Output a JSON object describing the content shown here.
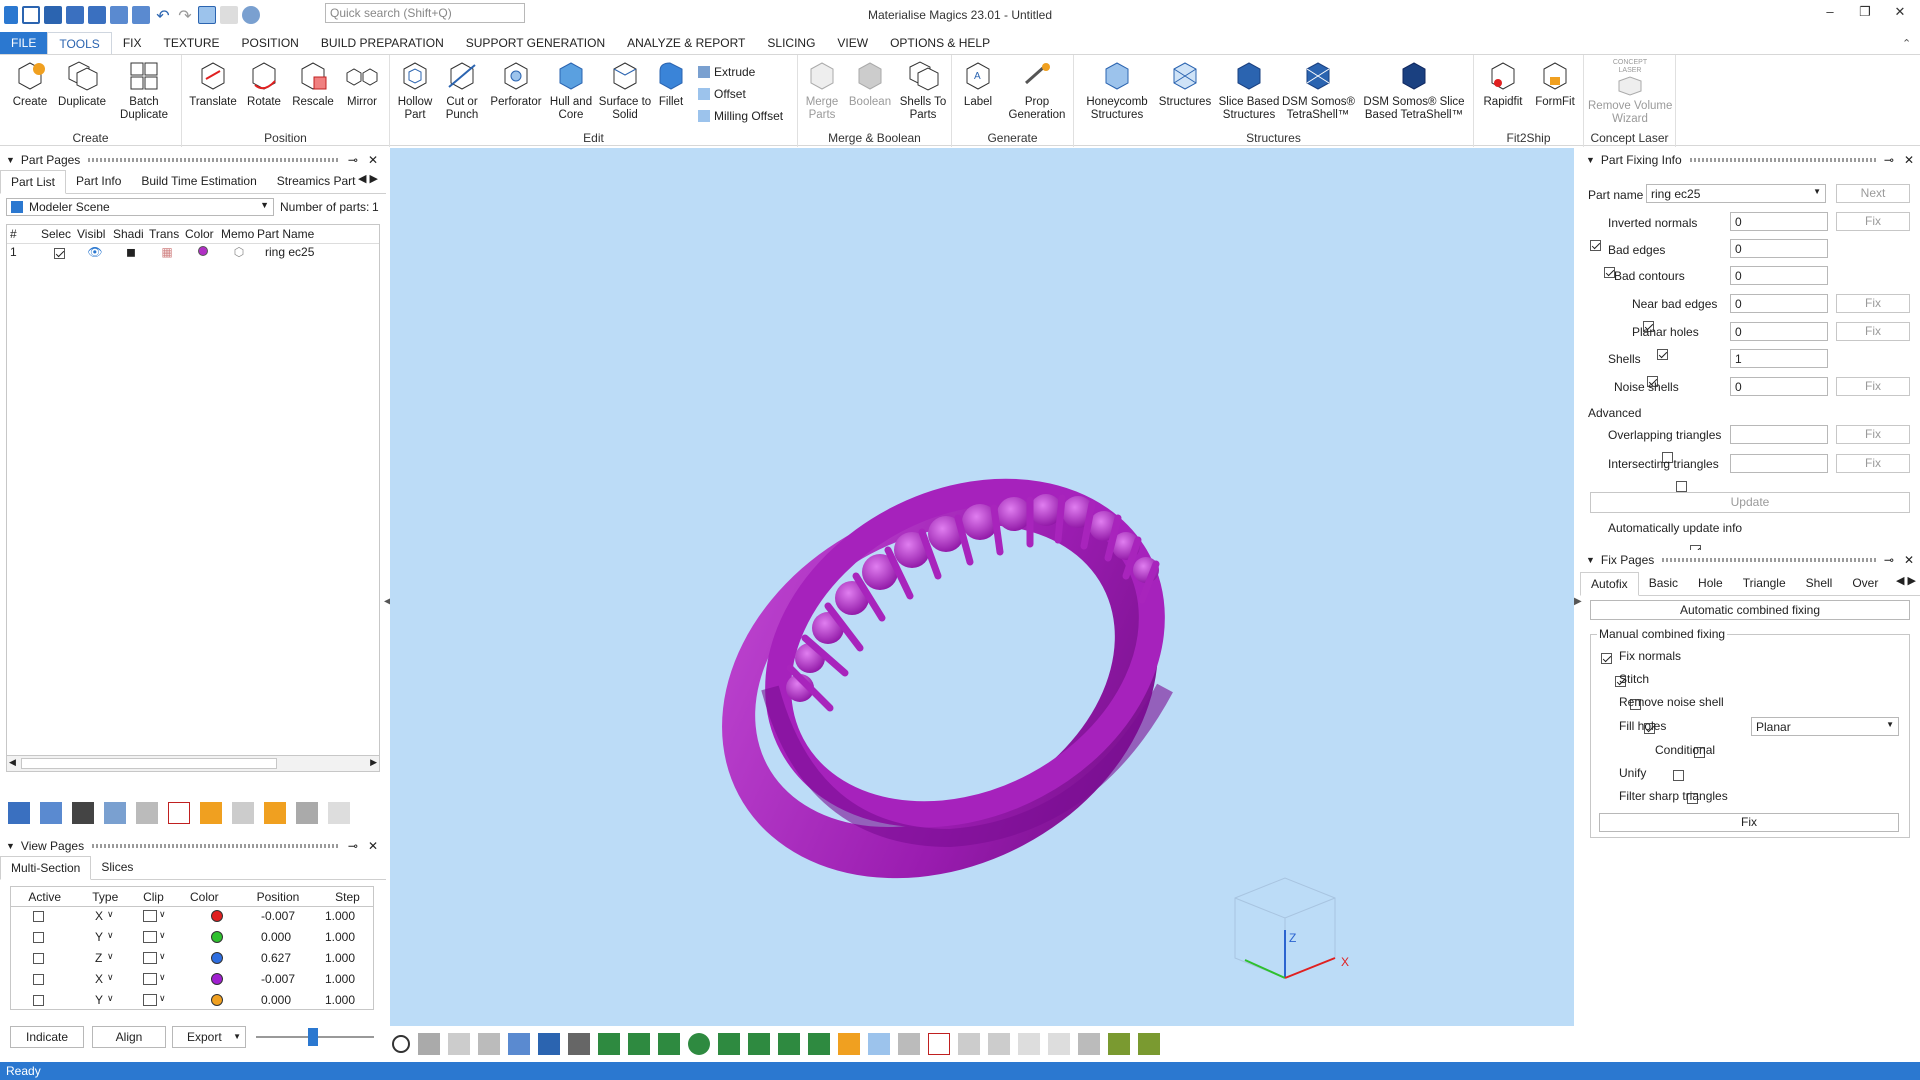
{
  "window": {
    "title": "Materialise Magics 23.01 - Untitled",
    "search_placeholder": "Quick search (Shift+Q)"
  },
  "menu": [
    "FILE",
    "TOOLS",
    "FIX",
    "TEXTURE",
    "POSITION",
    "BUILD PREPARATION",
    "SUPPORT GENERATION",
    "ANALYZE & REPORT",
    "SLICING",
    "VIEW",
    "OPTIONS & HELP"
  ],
  "ribbon": {
    "create": {
      "label": "Create",
      "buttons": [
        "Create",
        "Duplicate",
        "Batch\nDuplicate"
      ]
    },
    "position": {
      "label": "Position",
      "buttons": [
        "Translate",
        "Rotate",
        "Rescale",
        "Mirror"
      ]
    },
    "edit": {
      "label": "Edit",
      "buttons": [
        "Hollow\nPart",
        "Cut or\nPunch",
        "Perforator",
        "Hull and\nCore",
        "Surface to\nSolid",
        "Fillet"
      ],
      "small": [
        "Extrude",
        "Offset",
        "Milling Offset"
      ]
    },
    "merge": {
      "label": "Merge & Boolean",
      "buttons": [
        "Merge\nParts",
        "Boolean",
        "Shells To\nParts"
      ]
    },
    "generate": {
      "label": "Generate",
      "buttons": [
        "Label",
        "Prop\nGeneration"
      ]
    },
    "structures": {
      "label": "Structures",
      "buttons": [
        "Honeycomb\nStructures",
        "Structures",
        "Slice Based\nStructures",
        "DSM Somos®\nTetraShell™",
        "DSM Somos® Slice\nBased TetraShell™"
      ]
    },
    "fit2ship": {
      "label": "Fit2Ship",
      "buttons": [
        "Rapidfit",
        "FormFit"
      ]
    },
    "concept": {
      "label": "Concept Laser",
      "buttons": [
        "Remove Volume\nWizard"
      ],
      "badge": "CONCEPT\nLASER"
    }
  },
  "part_pages": {
    "title": "Part Pages",
    "tabs": [
      "Part List",
      "Part Info",
      "Build Time Estimation",
      "Streamics Part"
    ],
    "scene": "Modeler Scene",
    "parts_count_label": "Number of parts:",
    "parts_count": "1",
    "columns": [
      "#",
      "Selec",
      "Visibl",
      "Shadi",
      "Trans",
      "Color",
      "Memo",
      "Part Name"
    ],
    "rows": [
      {
        "num": "1",
        "name": "ring ec25"
      }
    ],
    "part_color": "#b02fc4"
  },
  "view_pages": {
    "title": "View Pages",
    "tabs": [
      "Multi-Section",
      "Slices"
    ],
    "columns": [
      "Active",
      "Type",
      "Clip",
      "Color",
      "Position",
      "Step"
    ],
    "rows": [
      {
        "type": "X",
        "color": "#e02020",
        "position": "-0.007",
        "step": "1.000"
      },
      {
        "type": "Y",
        "color": "#2ec02e",
        "position": "0.000",
        "step": "1.000"
      },
      {
        "type": "Z",
        "color": "#2e6ee0",
        "position": "0.627",
        "step": "1.000"
      },
      {
        "type": "X",
        "color": "#a020d0",
        "position": "-0.007",
        "step": "1.000"
      },
      {
        "type": "Y",
        "color": "#f0a020",
        "position": "0.000",
        "step": "1.000"
      }
    ],
    "buttons": [
      "Indicate",
      "Align",
      "Export"
    ]
  },
  "part_fixing": {
    "title": "Part Fixing Info",
    "part_name_label": "Part name",
    "part_name": "ring ec25",
    "next": "Next",
    "fix": "Fix",
    "rows": [
      {
        "label": "Inverted normals",
        "value": "0"
      },
      {
        "label": "Bad edges",
        "value": "0"
      },
      {
        "label": "Bad contours",
        "value": "0"
      },
      {
        "label": "Near bad edges",
        "value": "0"
      },
      {
        "label": "Planar holes",
        "value": "0"
      },
      {
        "label": "Shells",
        "value": "1"
      },
      {
        "label": "Noise shells",
        "value": "0"
      }
    ],
    "advanced": "Advanced",
    "overlapping": "Overlapping triangles",
    "intersecting": "Intersecting triangles",
    "update": "Update",
    "auto_update": "Automatically update info"
  },
  "fix_pages": {
    "title": "Fix Pages",
    "tabs": [
      "Autofix",
      "Basic",
      "Hole",
      "Triangle",
      "Shell",
      "Over"
    ],
    "auto_btn": "Automatic combined fixing",
    "manual_label": "Manual combined fixing",
    "options": [
      "Fix normals",
      "Stitch",
      "Remove noise shell",
      "Fill holes",
      "Conditional",
      "Unify",
      "Filter sharp triangles"
    ],
    "fill_mode": "Planar",
    "fix_btn": "Fix"
  },
  "status": "Ready",
  "axes": {
    "x": "X",
    "z": "Z"
  }
}
